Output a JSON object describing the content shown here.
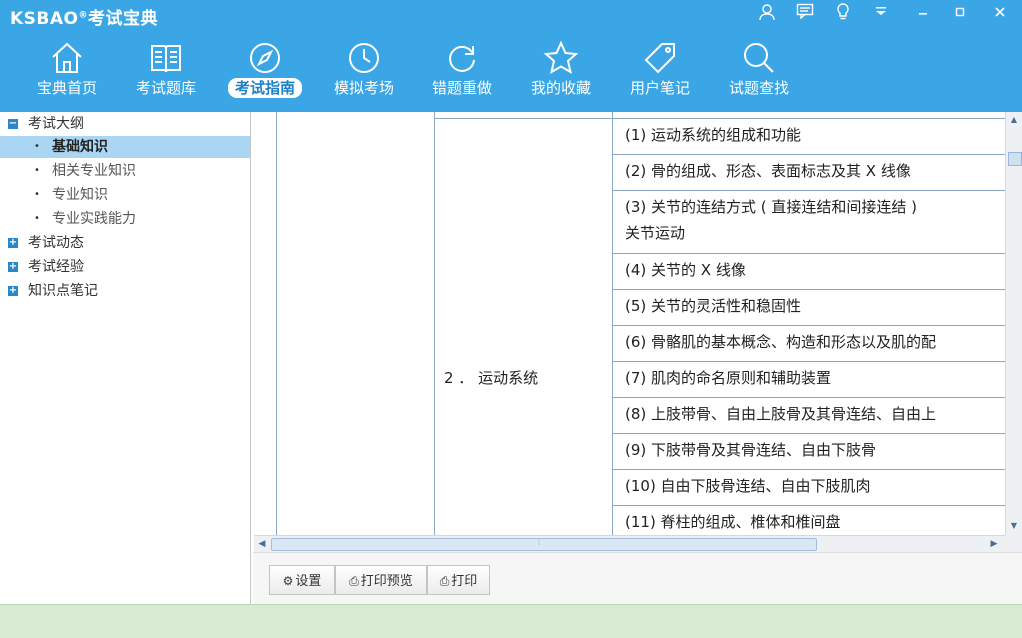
{
  "app": {
    "logo_text": "KSBAO",
    "logo_reg": "®",
    "logo_cn": "考试宝典"
  },
  "window_controls": [
    {
      "name": "user-icon",
      "glyph": "👤"
    },
    {
      "name": "message-icon",
      "glyph": "▭"
    },
    {
      "name": "tip-bulb-icon",
      "glyph": "💡"
    },
    {
      "name": "dropdown-menu-icon",
      "glyph": "▼"
    },
    {
      "name": "minimize-icon",
      "glyph": "–"
    },
    {
      "name": "maximize-icon",
      "glyph": "□"
    },
    {
      "name": "close-icon",
      "glyph": "✕"
    }
  ],
  "nav": {
    "active_index": 2,
    "items": [
      {
        "label": "宝典首页",
        "icon": "home-icon"
      },
      {
        "label": "考试题库",
        "icon": "book-icon"
      },
      {
        "label": "考试指南",
        "icon": "compass-icon"
      },
      {
        "label": "模拟考场",
        "icon": "clock-icon"
      },
      {
        "label": "错题重做",
        "icon": "refresh-icon"
      },
      {
        "label": "我的收藏",
        "icon": "star-icon"
      },
      {
        "label": "用户笔记",
        "icon": "tag-icon"
      },
      {
        "label": "试题查找",
        "icon": "search-icon"
      }
    ]
  },
  "sidebar": {
    "tree": [
      {
        "label": "考试大纲",
        "expanded": true,
        "children": [
          "基础知识",
          "相关专业知识",
          "专业知识",
          "专业实践能力"
        ],
        "selected_child": 0
      },
      {
        "label": "考试动态",
        "expanded": false
      },
      {
        "label": "考试经验",
        "expanded": false
      },
      {
        "label": "知识点笔记",
        "expanded": false
      }
    ],
    "expand_glyph": "+",
    "collapse_glyph": "−",
    "bullet": "•"
  },
  "content": {
    "section_label": "2 ． 运动系统",
    "items": [
      "(1) 运动系统的组成和功能",
      "(2) 骨的组成、形态、表面标志及其 X 线像",
      "(3) 关节的连结方式 ( 直接连结和间接连结 )",
      "(4) 关节的 X 线像",
      "(5) 关节的灵活性和稳固性",
      "(6) 骨骼肌的基本概念、构造和形态以及肌的配",
      "(7) 肌肉的命名原则和辅助装置",
      "(8) 上肢带骨、自由上肢骨及其骨连结、自由上",
      "(9) 下肢带骨及其骨连结、自由下肢骨",
      "(10) 自由下肢骨连结、自由下肢肌肉",
      "(11) 脊柱的组成、椎体和椎间盘"
    ],
    "item3_continuation": "关节运动"
  },
  "scrollbars": {
    "up": "▲",
    "down": "▼",
    "left": "◀",
    "right": "▶",
    "grip": "⦙"
  },
  "toolbar": {
    "settings_icon": "⚙",
    "settings_label": "设置",
    "preview_icon": "⎙",
    "preview_label": "打印预览",
    "print_icon": "⎙",
    "print_label": "打印"
  }
}
